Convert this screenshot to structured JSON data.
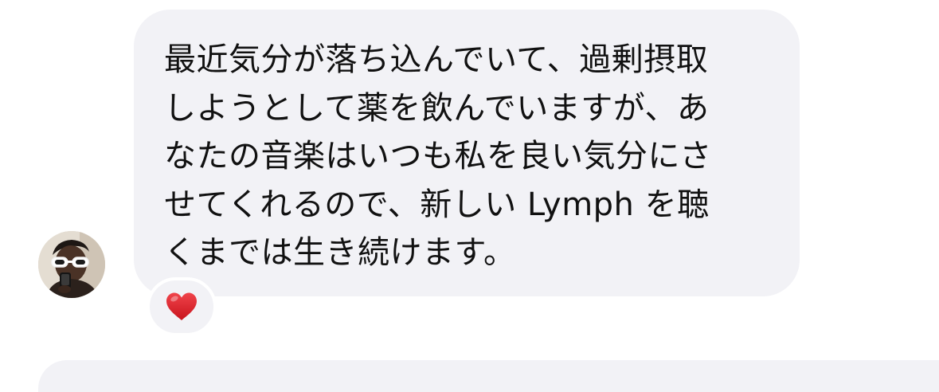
{
  "message": {
    "text": "最近気分が落ち込んでいて、過剰摂取\nしようとして薬を飲んでいますが、あ\nなたの音楽はいつも私を良い気分にさ\nせてくれるので、新しい Lymph を聴\nくまでは生き続けます。"
  },
  "reaction": {
    "icon": "heart-icon",
    "color": "#e0262e"
  },
  "colors": {
    "bubble_background": "#f2f2f6",
    "text": "#111111",
    "page_background": "#ffffff"
  }
}
